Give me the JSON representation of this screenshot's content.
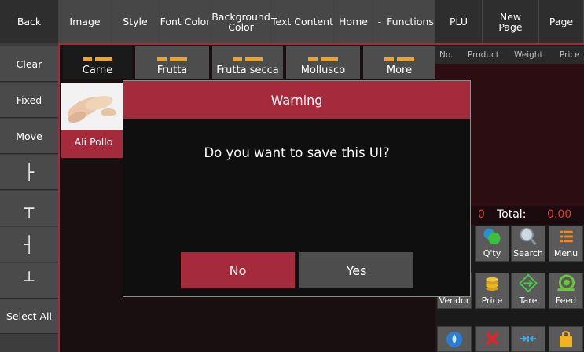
{
  "toolbar": {
    "back": "Back",
    "image": "Image",
    "style": "Style",
    "font_color": "Font Color",
    "background_color": "Background Color",
    "text_content": "Text Content",
    "home": "Home",
    "dash": "-",
    "functions": "Functions",
    "plu": "PLU",
    "new_page": "New Page",
    "page": "Page"
  },
  "sidebar": {
    "items": [
      {
        "label": "Clear"
      },
      {
        "label": "Fixed"
      },
      {
        "label": "Move"
      },
      {
        "label": "├",
        "icon": "align-left-icon"
      },
      {
        "label": "┬",
        "icon": "align-top-icon"
      },
      {
        "label": "┤",
        "icon": "align-right-icon"
      },
      {
        "label": "┴",
        "icon": "align-bottom-icon"
      },
      {
        "label": "Select All"
      }
    ]
  },
  "categories": [
    {
      "label": "Carne",
      "active": true
    },
    {
      "label": "Frutta"
    },
    {
      "label": "Frutta secca"
    },
    {
      "label": "Mollusco"
    },
    {
      "label": "More"
    }
  ],
  "product": {
    "label": "Ali Pollo"
  },
  "sale_table": {
    "headers": [
      "No.",
      "Product",
      "Weight",
      "Price"
    ],
    "count": "0",
    "total_label": "Total:",
    "total_value": "0.00"
  },
  "function_buttons": [
    {
      "label": "Q'ty",
      "icon": "quantity-icon"
    },
    {
      "label": "Search",
      "icon": "search-icon"
    },
    {
      "label": "Menu",
      "icon": "menu-icon"
    },
    {
      "label": "Vendor",
      "icon": "vendor-icon"
    },
    {
      "label": "Price",
      "icon": "coins-icon"
    },
    {
      "label": "Tare",
      "icon": "tare-icon"
    },
    {
      "label": "Feed",
      "icon": "feed-icon"
    }
  ],
  "dialog": {
    "title": "Warning",
    "message": "Do you want to save this UI?",
    "no_label": "No",
    "yes_label": "Yes"
  },
  "colors": {
    "accent_red": "#a52a3c",
    "orange": "#f4a41b",
    "total_red": "#e23c2c"
  }
}
